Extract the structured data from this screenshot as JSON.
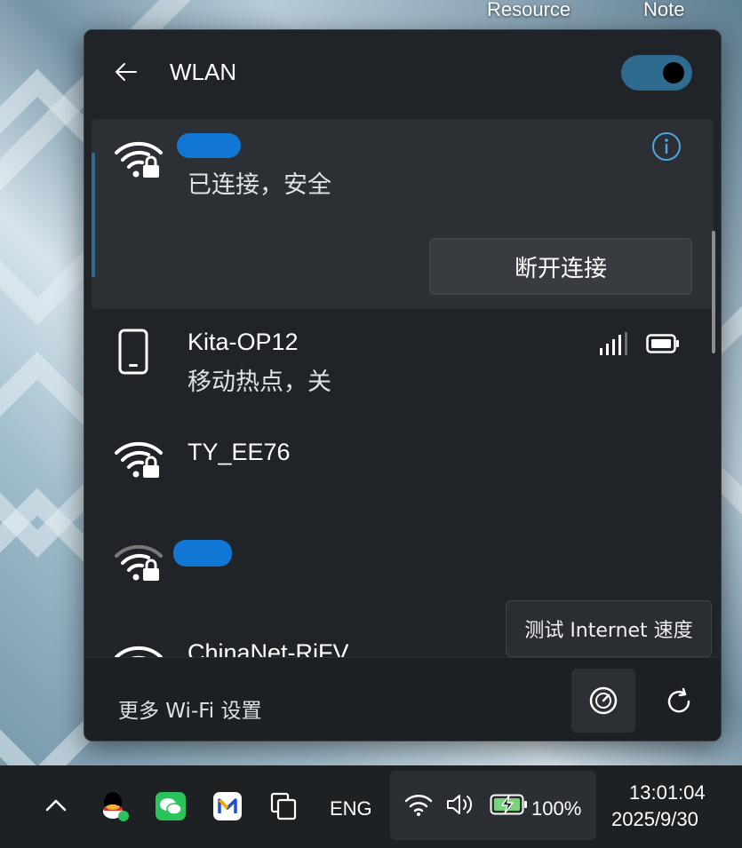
{
  "desktop": {
    "labels": [
      "Resource",
      "Note"
    ]
  },
  "panel": {
    "title": "WLAN",
    "wifi_enabled": true,
    "accent_color": "#2f6b8f",
    "networks": [
      {
        "name": "",
        "status": "已连接，安全",
        "icon": "wifi-secure-icon",
        "connected": true,
        "disconnect_label": "断开连接"
      },
      {
        "name": "Kita-OP12",
        "status": "移动热点，关",
        "icon": "phone-icon",
        "extra_icons": [
          "signal-bars-icon",
          "battery-icon"
        ]
      },
      {
        "name": "TY_EE76",
        "status": "",
        "icon": "wifi-secure-icon"
      },
      {
        "name": "",
        "status": "",
        "icon": "wifi-secure-icon"
      },
      {
        "name": "ChinaNet-RiFV",
        "status": "",
        "icon": "wifi-icon"
      }
    ],
    "footer": {
      "more_settings": "更多 Wi-Fi 设置"
    },
    "tooltip": "测试 Internet 速度"
  },
  "taskbar": {
    "language": "ENG",
    "battery": "100%",
    "time": "13:01:04",
    "date": "2025/9/30"
  }
}
